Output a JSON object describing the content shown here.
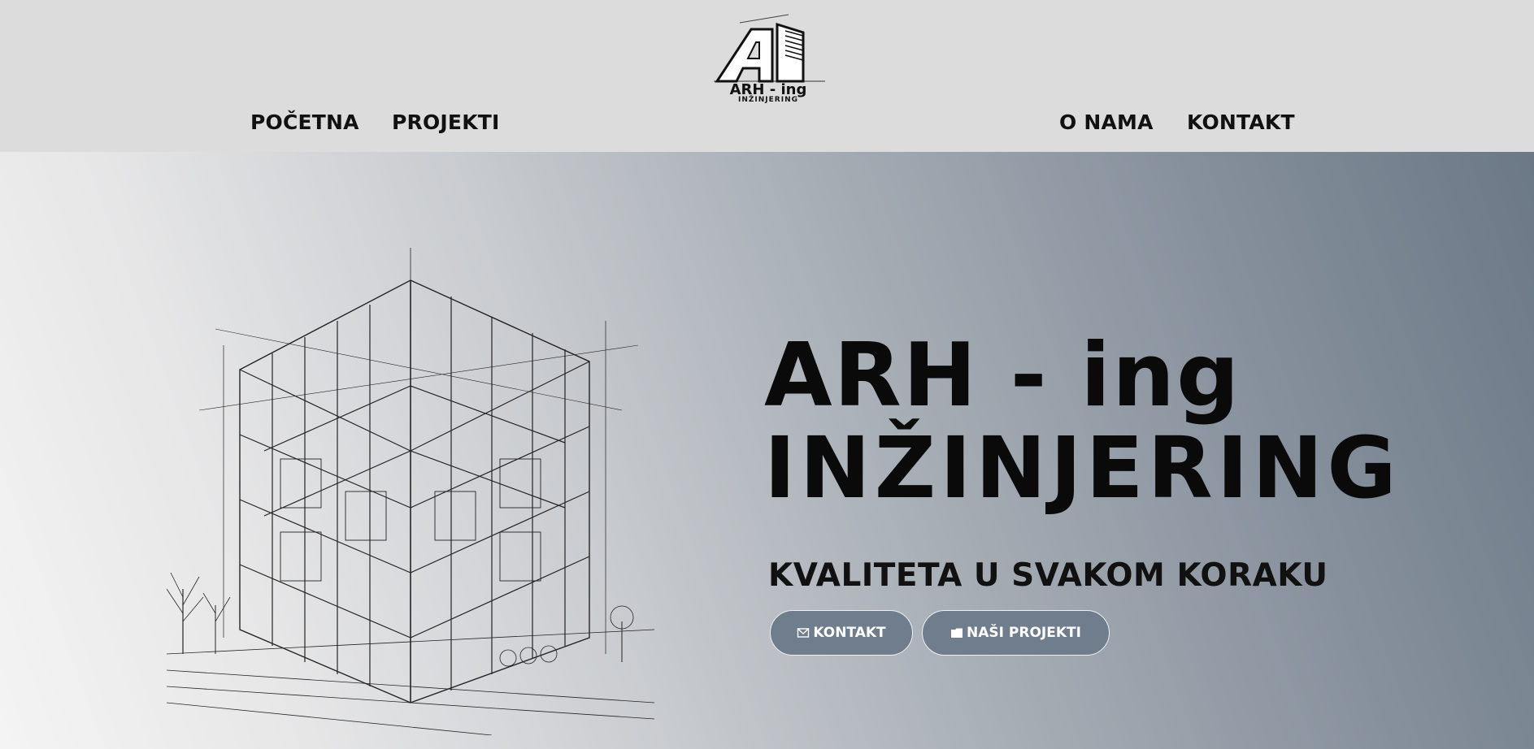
{
  "nav": {
    "home": "POČETNA",
    "projects": "PROJEKTI",
    "about": "O NAMA",
    "contact": "KONTAKT"
  },
  "logo": {
    "mark": "AI",
    "name": "ARH - ing",
    "tagline": "INŽINJERING"
  },
  "hero": {
    "title_line1": "ARH - ing",
    "title_line2": "INŽINJERING",
    "subtitle": "KVALITETA U SVAKOM KORAKU",
    "button_contact": "KONTAKT",
    "button_projects": "NAŠI PROJEKTI",
    "button_contact_icon": "envelope-icon",
    "button_projects_icon": "folder-icon"
  },
  "colors": {
    "header_bg": "#dcdcdd",
    "button_bg": "#707d8c",
    "text": "#111111"
  }
}
